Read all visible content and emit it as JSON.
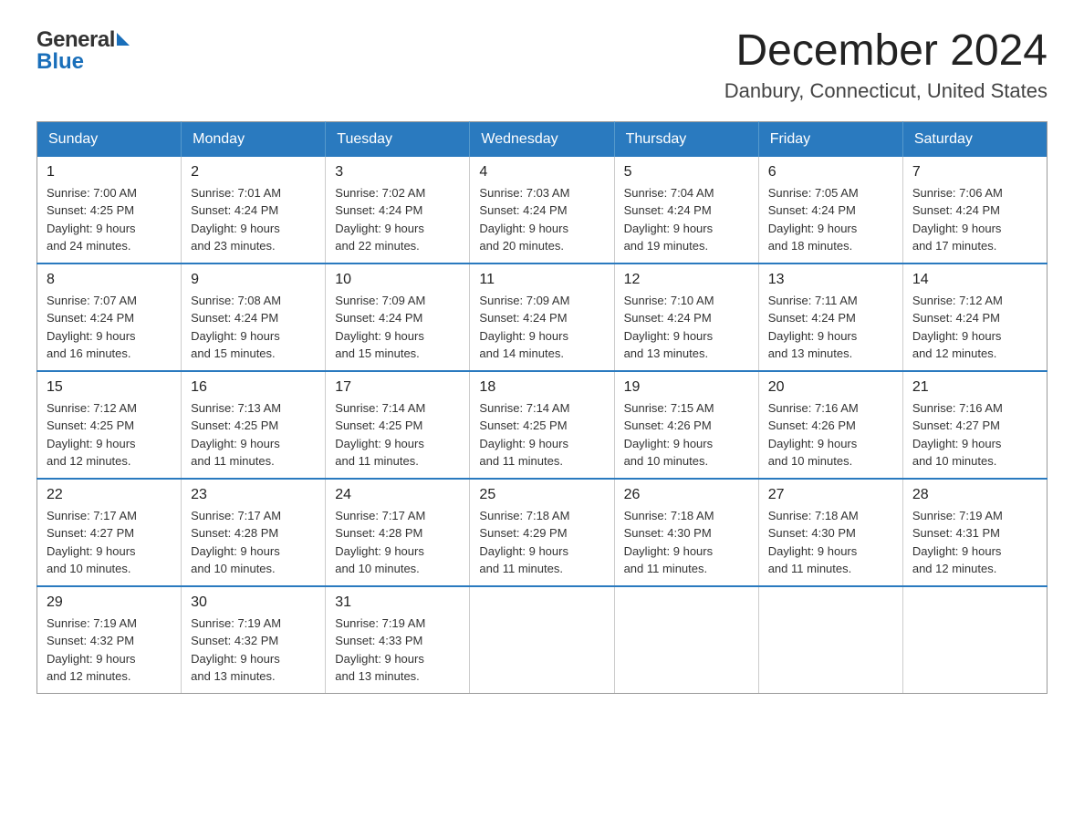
{
  "header": {
    "logo_general": "General",
    "logo_blue": "Blue",
    "month_title": "December 2024",
    "location": "Danbury, Connecticut, United States"
  },
  "weekdays": [
    "Sunday",
    "Monday",
    "Tuesday",
    "Wednesday",
    "Thursday",
    "Friday",
    "Saturday"
  ],
  "weeks": [
    [
      {
        "day": "1",
        "sunrise": "Sunrise: 7:00 AM",
        "sunset": "Sunset: 4:25 PM",
        "daylight": "Daylight: 9 hours",
        "daylight2": "and 24 minutes."
      },
      {
        "day": "2",
        "sunrise": "Sunrise: 7:01 AM",
        "sunset": "Sunset: 4:24 PM",
        "daylight": "Daylight: 9 hours",
        "daylight2": "and 23 minutes."
      },
      {
        "day": "3",
        "sunrise": "Sunrise: 7:02 AM",
        "sunset": "Sunset: 4:24 PM",
        "daylight": "Daylight: 9 hours",
        "daylight2": "and 22 minutes."
      },
      {
        "day": "4",
        "sunrise": "Sunrise: 7:03 AM",
        "sunset": "Sunset: 4:24 PM",
        "daylight": "Daylight: 9 hours",
        "daylight2": "and 20 minutes."
      },
      {
        "day": "5",
        "sunrise": "Sunrise: 7:04 AM",
        "sunset": "Sunset: 4:24 PM",
        "daylight": "Daylight: 9 hours",
        "daylight2": "and 19 minutes."
      },
      {
        "day": "6",
        "sunrise": "Sunrise: 7:05 AM",
        "sunset": "Sunset: 4:24 PM",
        "daylight": "Daylight: 9 hours",
        "daylight2": "and 18 minutes."
      },
      {
        "day": "7",
        "sunrise": "Sunrise: 7:06 AM",
        "sunset": "Sunset: 4:24 PM",
        "daylight": "Daylight: 9 hours",
        "daylight2": "and 17 minutes."
      }
    ],
    [
      {
        "day": "8",
        "sunrise": "Sunrise: 7:07 AM",
        "sunset": "Sunset: 4:24 PM",
        "daylight": "Daylight: 9 hours",
        "daylight2": "and 16 minutes."
      },
      {
        "day": "9",
        "sunrise": "Sunrise: 7:08 AM",
        "sunset": "Sunset: 4:24 PM",
        "daylight": "Daylight: 9 hours",
        "daylight2": "and 15 minutes."
      },
      {
        "day": "10",
        "sunrise": "Sunrise: 7:09 AM",
        "sunset": "Sunset: 4:24 PM",
        "daylight": "Daylight: 9 hours",
        "daylight2": "and 15 minutes."
      },
      {
        "day": "11",
        "sunrise": "Sunrise: 7:09 AM",
        "sunset": "Sunset: 4:24 PM",
        "daylight": "Daylight: 9 hours",
        "daylight2": "and 14 minutes."
      },
      {
        "day": "12",
        "sunrise": "Sunrise: 7:10 AM",
        "sunset": "Sunset: 4:24 PM",
        "daylight": "Daylight: 9 hours",
        "daylight2": "and 13 minutes."
      },
      {
        "day": "13",
        "sunrise": "Sunrise: 7:11 AM",
        "sunset": "Sunset: 4:24 PM",
        "daylight": "Daylight: 9 hours",
        "daylight2": "and 13 minutes."
      },
      {
        "day": "14",
        "sunrise": "Sunrise: 7:12 AM",
        "sunset": "Sunset: 4:24 PM",
        "daylight": "Daylight: 9 hours",
        "daylight2": "and 12 minutes."
      }
    ],
    [
      {
        "day": "15",
        "sunrise": "Sunrise: 7:12 AM",
        "sunset": "Sunset: 4:25 PM",
        "daylight": "Daylight: 9 hours",
        "daylight2": "and 12 minutes."
      },
      {
        "day": "16",
        "sunrise": "Sunrise: 7:13 AM",
        "sunset": "Sunset: 4:25 PM",
        "daylight": "Daylight: 9 hours",
        "daylight2": "and 11 minutes."
      },
      {
        "day": "17",
        "sunrise": "Sunrise: 7:14 AM",
        "sunset": "Sunset: 4:25 PM",
        "daylight": "Daylight: 9 hours",
        "daylight2": "and 11 minutes."
      },
      {
        "day": "18",
        "sunrise": "Sunrise: 7:14 AM",
        "sunset": "Sunset: 4:25 PM",
        "daylight": "Daylight: 9 hours",
        "daylight2": "and 11 minutes."
      },
      {
        "day": "19",
        "sunrise": "Sunrise: 7:15 AM",
        "sunset": "Sunset: 4:26 PM",
        "daylight": "Daylight: 9 hours",
        "daylight2": "and 10 minutes."
      },
      {
        "day": "20",
        "sunrise": "Sunrise: 7:16 AM",
        "sunset": "Sunset: 4:26 PM",
        "daylight": "Daylight: 9 hours",
        "daylight2": "and 10 minutes."
      },
      {
        "day": "21",
        "sunrise": "Sunrise: 7:16 AM",
        "sunset": "Sunset: 4:27 PM",
        "daylight": "Daylight: 9 hours",
        "daylight2": "and 10 minutes."
      }
    ],
    [
      {
        "day": "22",
        "sunrise": "Sunrise: 7:17 AM",
        "sunset": "Sunset: 4:27 PM",
        "daylight": "Daylight: 9 hours",
        "daylight2": "and 10 minutes."
      },
      {
        "day": "23",
        "sunrise": "Sunrise: 7:17 AM",
        "sunset": "Sunset: 4:28 PM",
        "daylight": "Daylight: 9 hours",
        "daylight2": "and 10 minutes."
      },
      {
        "day": "24",
        "sunrise": "Sunrise: 7:17 AM",
        "sunset": "Sunset: 4:28 PM",
        "daylight": "Daylight: 9 hours",
        "daylight2": "and 10 minutes."
      },
      {
        "day": "25",
        "sunrise": "Sunrise: 7:18 AM",
        "sunset": "Sunset: 4:29 PM",
        "daylight": "Daylight: 9 hours",
        "daylight2": "and 11 minutes."
      },
      {
        "day": "26",
        "sunrise": "Sunrise: 7:18 AM",
        "sunset": "Sunset: 4:30 PM",
        "daylight": "Daylight: 9 hours",
        "daylight2": "and 11 minutes."
      },
      {
        "day": "27",
        "sunrise": "Sunrise: 7:18 AM",
        "sunset": "Sunset: 4:30 PM",
        "daylight": "Daylight: 9 hours",
        "daylight2": "and 11 minutes."
      },
      {
        "day": "28",
        "sunrise": "Sunrise: 7:19 AM",
        "sunset": "Sunset: 4:31 PM",
        "daylight": "Daylight: 9 hours",
        "daylight2": "and 12 minutes."
      }
    ],
    [
      {
        "day": "29",
        "sunrise": "Sunrise: 7:19 AM",
        "sunset": "Sunset: 4:32 PM",
        "daylight": "Daylight: 9 hours",
        "daylight2": "and 12 minutes."
      },
      {
        "day": "30",
        "sunrise": "Sunrise: 7:19 AM",
        "sunset": "Sunset: 4:32 PM",
        "daylight": "Daylight: 9 hours",
        "daylight2": "and 13 minutes."
      },
      {
        "day": "31",
        "sunrise": "Sunrise: 7:19 AM",
        "sunset": "Sunset: 4:33 PM",
        "daylight": "Daylight: 9 hours",
        "daylight2": "and 13 minutes."
      },
      null,
      null,
      null,
      null
    ]
  ]
}
